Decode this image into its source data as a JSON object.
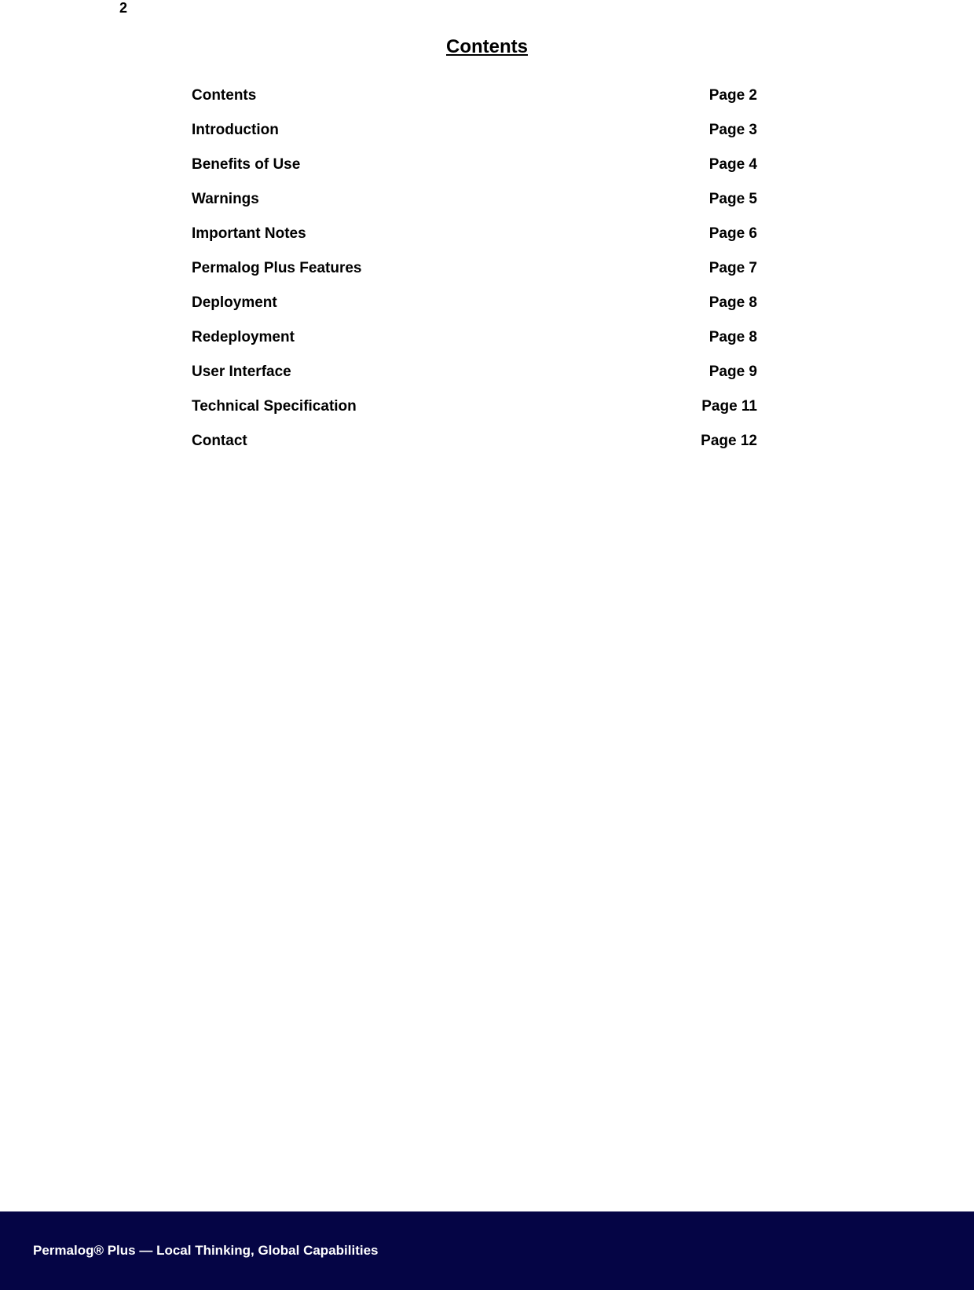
{
  "page_number": "2",
  "title": "Contents",
  "toc": [
    {
      "label": "Contents",
      "page": "Page 2"
    },
    {
      "label": "Introduction",
      "page": "Page 3"
    },
    {
      "label": "Benefits of Use",
      "page": "Page 4"
    },
    {
      "label": "Warnings",
      "page": "Page 5"
    },
    {
      "label": "Important Notes",
      "page": "Page 6"
    },
    {
      "label": "Permalog Plus Features",
      "page": "Page 7"
    },
    {
      "label": "Deployment",
      "page": "Page 8"
    },
    {
      "label": "Redeployment",
      "page": "Page 8"
    },
    {
      "label": "User Interface",
      "page": "Page 9"
    },
    {
      "label": "Technical Specification",
      "page": "Page 11"
    },
    {
      "label": "Contact",
      "page": "Page 12"
    }
  ],
  "footer": {
    "text": "Permalog® Plus — Local Thinking, Global Capabilities"
  }
}
